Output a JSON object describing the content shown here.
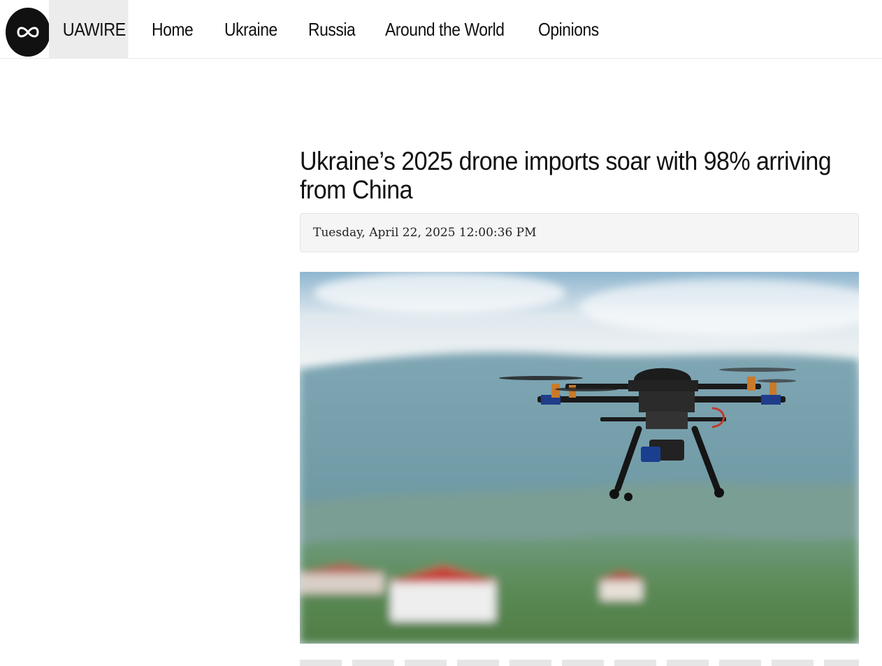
{
  "nav": {
    "logo_icon": "infinity-icon",
    "brand": "UAWIRE",
    "links": [
      "Home",
      "Ukraine",
      "Russia",
      "Around the World",
      "Opinions"
    ]
  },
  "article": {
    "title": "Ukraine’s 2025 drone imports soar with 98% arriving from China",
    "date": "Tuesday, April 22, 2025 12:00:36 PM",
    "image_subject": "quadcopter-drone-photo"
  }
}
